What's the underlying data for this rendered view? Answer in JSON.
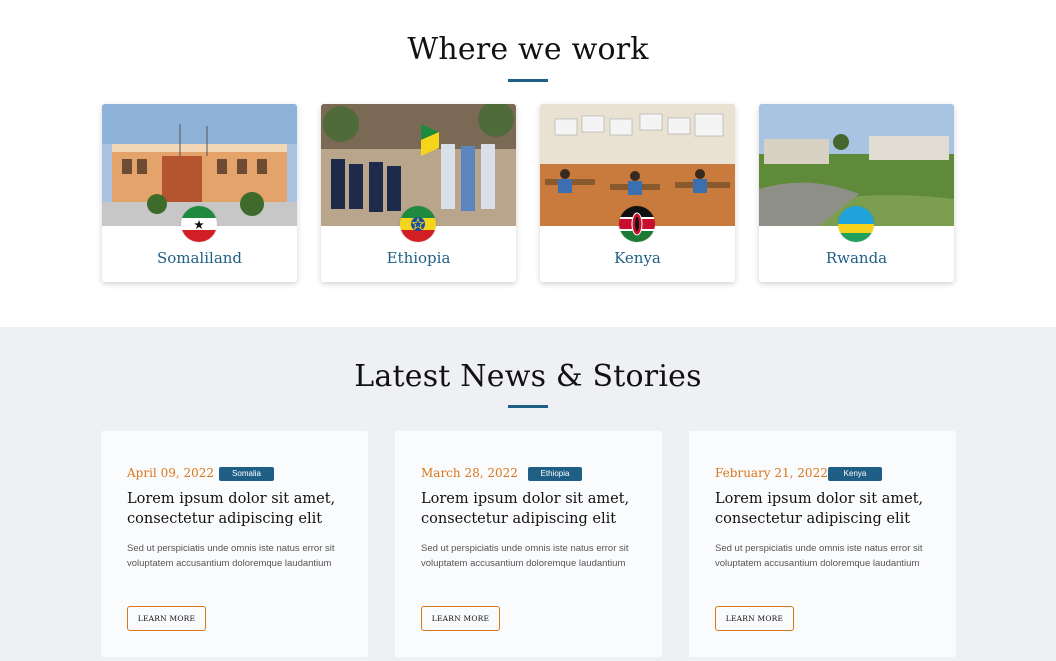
{
  "where_we_work": {
    "title": "Where we work",
    "countries": [
      {
        "name": "Somaliland",
        "photo_icon": "school-building-photo",
        "flag_icon": "somaliland-flag-icon"
      },
      {
        "name": "Ethiopia",
        "photo_icon": "students-assembly-photo",
        "flag_icon": "ethiopia-flag-icon"
      },
      {
        "name": "Kenya",
        "photo_icon": "classroom-photo",
        "flag_icon": "kenya-flag-icon"
      },
      {
        "name": "Rwanda",
        "photo_icon": "school-campus-photo",
        "flag_icon": "rwanda-flag-icon"
      }
    ]
  },
  "news": {
    "title": "Latest News & Stories",
    "items": [
      {
        "date": "April 09, 2022",
        "tag": "Somalia",
        "heading": "Lorem ipsum dolor sit amet, consectetur adipiscing elit",
        "text": "Sed ut perspiciatis unde omnis iste natus error sit voluptatem accusantium doloremque laudantium",
        "button": "LEARN MORE"
      },
      {
        "date": "March 28, 2022",
        "tag": "Ethiopia",
        "heading": "Lorem ipsum dolor sit amet, consectetur adipiscing elit",
        "text": "Sed ut perspiciatis unde omnis iste natus error sit voluptatem accusantium doloremque laudantium",
        "button": "LEARN MORE"
      },
      {
        "date": "February 21, 2022",
        "tag": "Kenya",
        "heading": "Lorem ipsum dolor sit amet, consectetur adipiscing elit",
        "text": "Sed ut perspiciatis unde omnis iste natus error sit voluptatem accusantium doloremque laudantium",
        "button": "LEARN MORE"
      }
    ]
  },
  "colors": {
    "accent_blue": "#1f5f86",
    "accent_orange": "#d9771b",
    "news_background": "#eef0f4"
  }
}
